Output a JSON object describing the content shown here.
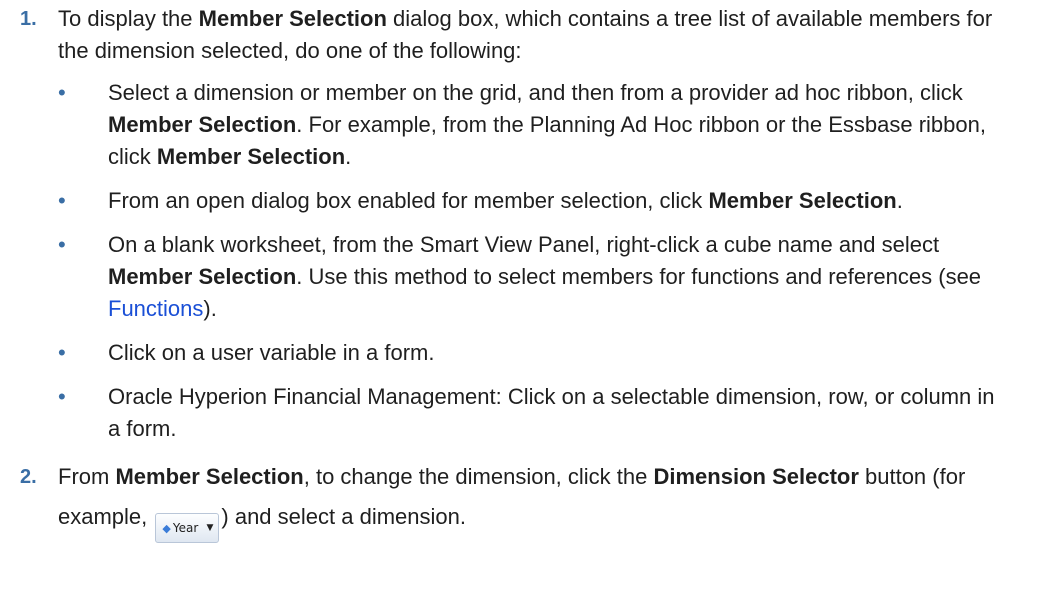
{
  "steps": [
    {
      "number": "1.",
      "intro_before": "To display the ",
      "intro_bold": "Member Selection",
      "intro_after": " dialog box, which contains a tree list of available members for the dimension selected, do one of the following:",
      "bullets": [
        {
          "t1": "Select a dimension or member on the grid, and then from a provider ad hoc ribbon, click ",
          "b1": "Member Selection",
          "t2": ". For example, from the Planning Ad Hoc ribbon or the Essbase ribbon, click ",
          "b2": "Member Selection",
          "t3": "."
        },
        {
          "t1": "From an open dialog box enabled for member selection, click ",
          "b1": "Member Selection",
          "t2": "."
        },
        {
          "t1": "On a blank worksheet, from the Smart View Panel, right-click a cube name and select ",
          "b1": "Member Selection",
          "t2": ". Use this method to select members for functions and references (see ",
          "link": "Functions",
          "t3": ")."
        },
        {
          "t1": "Click on a user variable in a form."
        },
        {
          "t1": "Oracle Hyperion Financial Management: Click on a selectable dimension, row, or column in a form."
        }
      ]
    },
    {
      "number": "2.",
      "t1": "From ",
      "b1": "Member Selection",
      "t2": ", to change the dimension, click the ",
      "b2": "Dimension Selector",
      "t3": " button (for example, ",
      "t4": ") and select a dimension."
    }
  ],
  "bullet_glyph": "•",
  "dimension_button": {
    "label": "Year",
    "icon": "gem-icon",
    "caret": "chevron-down-icon"
  },
  "colors": {
    "accent": "#3a6ea5",
    "link": "#1a4fd6",
    "text": "#1f1f1f"
  }
}
